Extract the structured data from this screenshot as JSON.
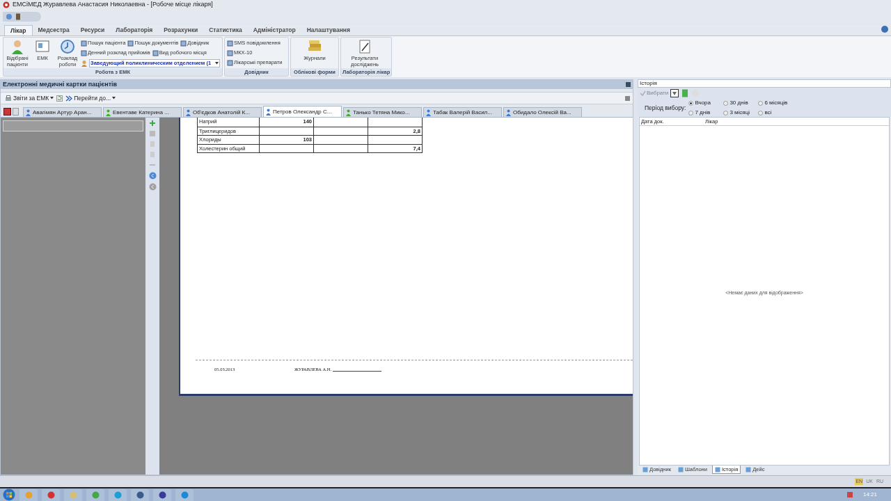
{
  "window": {
    "title": "ЕМСіМЕД Журавлева Анастасия Николаевна - [Робоче місце лікаря]"
  },
  "ribbon_tabs": [
    {
      "label": "Лікар",
      "selected": true
    },
    {
      "label": "Медсестра",
      "selected": false
    },
    {
      "label": "Ресурси",
      "selected": false
    },
    {
      "label": "Лабораторія",
      "selected": false
    },
    {
      "label": "Розрахунки",
      "selected": false
    },
    {
      "label": "Статистика",
      "selected": false
    },
    {
      "label": "Адміністратор",
      "selected": false
    },
    {
      "label": "Налаштування",
      "selected": false
    }
  ],
  "ribbon_groups": [
    {
      "label": "Робота з ЕМК",
      "large_buttons": [
        "Відібрані пацієнти",
        "ЕМК",
        "Розклад роботи"
      ],
      "small_buttons": [
        "Пошук пацієнта",
        "Пошук документів",
        "Довідник",
        "Денний розклад прийомів",
        "Вид робочого місця"
      ],
      "combo": "Заведующий поликлиническим отделением (1"
    },
    {
      "label": "Довідник",
      "small_buttons": [
        "SMS повідомлення",
        "МКХ-10",
        "Лікарські препарати"
      ]
    },
    {
      "label": "Облікові форми",
      "large_buttons": [
        "Журнали"
      ]
    },
    {
      "label": "Лабораторія лікар",
      "large_buttons": [
        "Результати досліджень"
      ]
    }
  ],
  "main_panel": {
    "title": "Електронні медичні картки пацієнтів",
    "toolbar": [
      "Звіти за ЕМК",
      "Перейти до..."
    ],
    "patient_tabs": [
      {
        "label": "Авагімян Артур Аран...",
        "selected": false,
        "color": "#3a7bd5"
      },
      {
        "label": "Евентаве Катерина ...",
        "selected": false,
        "color": "#3fae2a"
      },
      {
        "label": "Об'єдков Анатолій К...",
        "selected": false,
        "color": "#3a7bd5"
      },
      {
        "label": "Петров Олександр С...",
        "selected": true,
        "color": "#3a7bd5"
      },
      {
        "label": "Танько Тетяна Мико...",
        "selected": false,
        "color": "#3fae2a"
      },
      {
        "label": "Табак Валерій Васил...",
        "selected": false,
        "color": "#3a7bd5"
      },
      {
        "label": "Обидало Олексій Ва...",
        "selected": false,
        "color": "#3a7bd5"
      }
    ],
    "document": {
      "rows": [
        [
          "Натрий",
          "140",
          "",
          ""
        ],
        [
          "Триглицеридов",
          "",
          "",
          "2,8"
        ],
        [
          "Хлориды",
          "103",
          "",
          ""
        ],
        [
          "Холестерин общий",
          "",
          "",
          "7,4"
        ]
      ],
      "footer_date": "05.03.2013",
      "footer_signature": "ЖУРАВЛЕВА А.Н."
    }
  },
  "history_panel": {
    "title": "Історія",
    "select_button": {
      "label": "Вибрати",
      "disabled": true
    },
    "period_label": "Період вибору:",
    "periods": [
      {
        "label": "Вчора",
        "selected": true
      },
      {
        "label": "30 днів",
        "selected": false
      },
      {
        "label": "6 місяців",
        "selected": false
      },
      {
        "label": "7 днів",
        "selected": false
      },
      {
        "label": "3 місяці",
        "selected": false
      },
      {
        "label": "всі",
        "selected": false
      }
    ],
    "columns": [
      "Дата док.",
      "Лікар"
    ],
    "empty_text": "<Немає даних для відображення>",
    "bottom_tabs": [
      {
        "label": "Довідник",
        "selected": false
      },
      {
        "label": "Шаблони",
        "selected": false
      },
      {
        "label": "Історія",
        "selected": true
      },
      {
        "label": "Дейс",
        "selected": false
      }
    ]
  },
  "status_bar": {
    "languages": [
      {
        "label": "EN",
        "selected": true
      },
      {
        "label": "UK",
        "selected": false
      },
      {
        "label": "RU",
        "selected": false
      }
    ]
  },
  "taskbar": {
    "clock": "14:21"
  }
}
